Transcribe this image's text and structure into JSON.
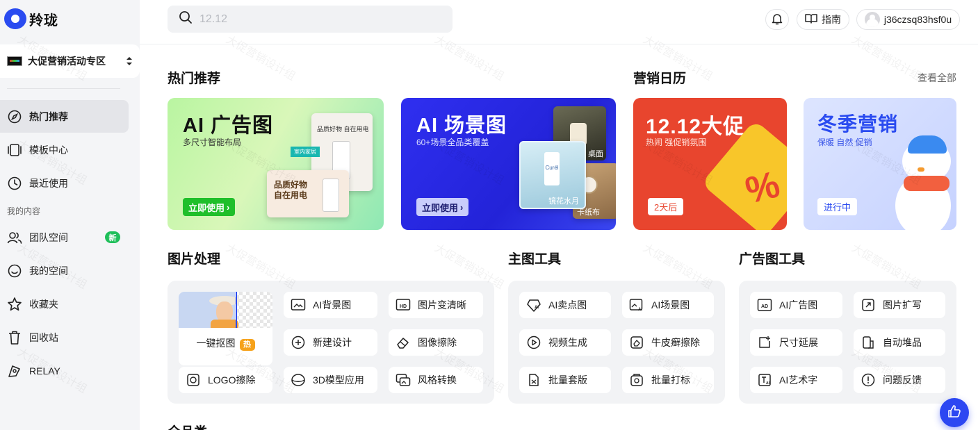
{
  "app": {
    "name": "羚珑"
  },
  "search": {
    "placeholder": "12.12"
  },
  "header": {
    "guide_label": "指南",
    "username": "j36czsq83hsf0u"
  },
  "sidebar": {
    "space_name": "大促营销活动专区",
    "items": [
      {
        "label": "热门推荐",
        "icon": "compass-icon"
      },
      {
        "label": "模板中心",
        "icon": "template-icon"
      },
      {
        "label": "最近使用",
        "icon": "clock-icon"
      }
    ],
    "section_label": "我的内容",
    "my_items": [
      {
        "label": "团队空间",
        "icon": "team-icon",
        "badge": "新"
      },
      {
        "label": "我的空间",
        "icon": "smile-icon"
      },
      {
        "label": "收藏夹",
        "icon": "star-icon"
      },
      {
        "label": "回收站",
        "icon": "trash-icon"
      },
      {
        "label": "RELAY",
        "icon": "relay-icon"
      }
    ]
  },
  "hot": {
    "title": "热门推荐",
    "banners": [
      {
        "title": "AI 广告图",
        "subtitle": "多尺寸智能布局",
        "cta": "立即使用",
        "tags": [
          "品质好物 自在用电",
          "室内家居",
          "品质好物",
          "自在用电"
        ]
      },
      {
        "title": "AI 场景图",
        "subtitle": "60+场景全品类覆盖",
        "cta": "立即使用",
        "tags": [
          "桌面",
          "镜花水月",
          "卡纸布"
        ]
      }
    ]
  },
  "calendar": {
    "title": "营销日历",
    "see_all": "查看全部",
    "cards": [
      {
        "title": "12.12大促",
        "subtitle": "热闹 强促销氛围",
        "badge": "2天后",
        "color": "#e8452e"
      },
      {
        "title": "冬季营销",
        "subtitle": "保暖 自然 促销",
        "badge": "进行中",
        "color": "#2a4bf0"
      }
    ]
  },
  "image_tools": {
    "title": "图片处理",
    "featured": {
      "label": "一键抠图",
      "tag": "热"
    },
    "items": [
      "AI背景图",
      "图片变清晰",
      "新建设计",
      "图像擦除",
      "LOGO擦除",
      "3D模型应用",
      "风格转换"
    ]
  },
  "main_tools": {
    "title": "主图工具",
    "items": [
      "AI卖点图",
      "AI场景图",
      "视频生成",
      "牛皮癣擦除",
      "批量套版",
      "批量打标"
    ]
  },
  "ad_tools": {
    "title": "广告图工具",
    "items": [
      "AI广告图",
      "图片扩写",
      "尺寸延展",
      "自动堆品",
      "AI艺术字",
      "问题反馈"
    ]
  },
  "next_section": {
    "title": "全品类"
  },
  "watermark_text": "大促营销设计组"
}
